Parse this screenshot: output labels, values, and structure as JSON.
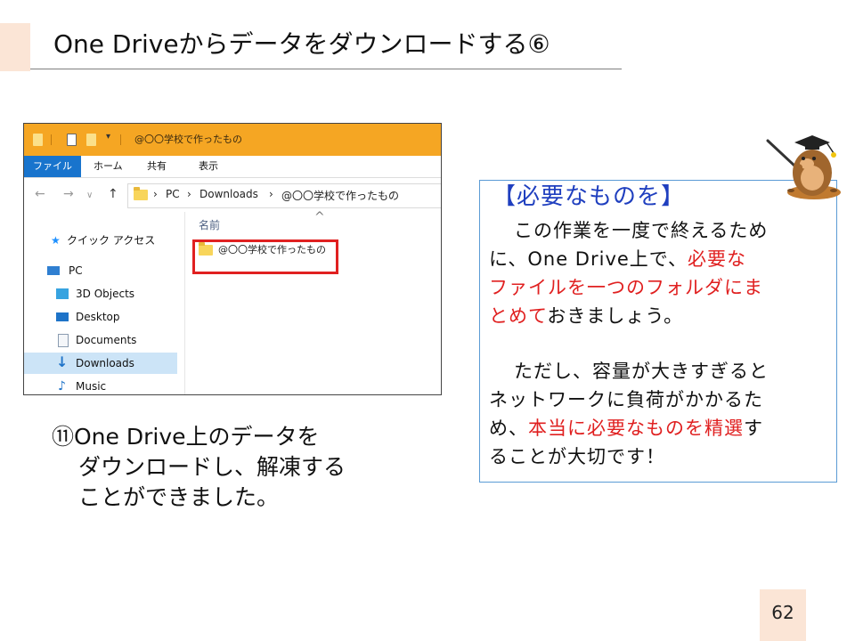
{
  "slide": {
    "title": "One Driveからデータをダウンロードする⑥",
    "page_number": "62"
  },
  "explorer": {
    "window_title": "@〇〇学校で作ったもの",
    "menu": [
      "ファイル",
      "ホーム",
      "共有",
      "表示"
    ],
    "breadcrumb": [
      "PC",
      "Downloads",
      "@〇〇学校で作ったもの"
    ],
    "nav_back": "←",
    "nav_forward": "→",
    "nav_recent": "∨",
    "nav_up": "↑",
    "breadcrumb_sep": "›",
    "sidebar": [
      {
        "label": "クイック アクセス",
        "icon": "star-icon",
        "color": "#1e90ff"
      },
      {
        "label": "PC",
        "icon": "computer-icon",
        "color": "#2f7fd1"
      },
      {
        "label": "3D Objects",
        "icon": "cube-icon",
        "color": "#37a3e0"
      },
      {
        "label": "Desktop",
        "icon": "desktop-icon",
        "color": "#1e73c8"
      },
      {
        "label": "Documents",
        "icon": "document-icon",
        "color": "#8a9bb0"
      },
      {
        "label": "Downloads",
        "icon": "download-arrow-icon",
        "color": "#1e73c8",
        "selected": true
      },
      {
        "label": "Music",
        "icon": "music-note-icon",
        "color": "#1e73c8"
      }
    ],
    "column_header": "名前",
    "sort_caret": "^",
    "items": [
      "@〇〇学校で作ったもの"
    ]
  },
  "caption": {
    "lines": [
      "⑪One Drive上のデータを",
      "ダウンロードし、解凍する",
      "ことができました。"
    ]
  },
  "note": {
    "heading": "【必要なものを】",
    "p1_l1": "この作業を一度で終えるため",
    "p1_l2_a": "に、One Drive上で、",
    "p1_l2_b": "必要な",
    "p1_l3": "ファイルを一つのフォルダにま",
    "p1_l4_a": "とめて",
    "p1_l4_b": "おきましょう。",
    "p2_l1": "ただし、容量が大きすぎると",
    "p2_l2": "ネットワークに負荷がかかるた",
    "p2_l3_a": "め、",
    "p2_l3_b": "本当に必要なものを精選",
    "p2_l3_c": "す",
    "p2_l4": "ることが大切です！"
  },
  "colors": {
    "accent_bar": "#fbe5d6",
    "explorer_titlebar": "#f5a623",
    "file_tab": "#1874cd",
    "highlight_red": "#e02020",
    "note_border": "#5b9bd5",
    "heading_blue": "#1f3fbf"
  }
}
